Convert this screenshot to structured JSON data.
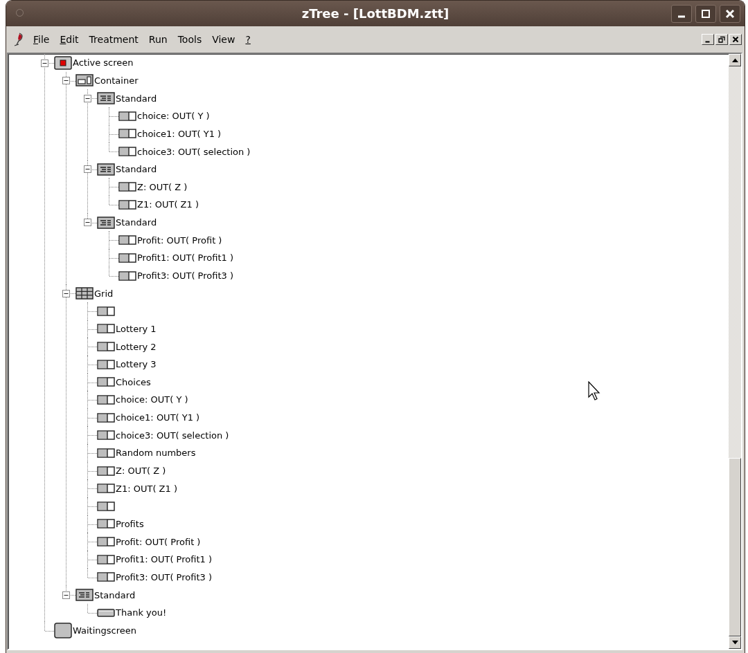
{
  "window": {
    "title": "zTree - [LottBDM.ztt]"
  },
  "menu": [
    {
      "label": "File",
      "mnemonic": true
    },
    {
      "label": "Edit",
      "mnemonic": true
    },
    {
      "label": "Treatment",
      "mnemonic": false
    },
    {
      "label": "Run",
      "mnemonic": false
    },
    {
      "label": "Tools",
      "mnemonic": false
    },
    {
      "label": "View",
      "mnemonic": false
    },
    {
      "label": "?",
      "mnemonic": true
    }
  ],
  "tree": [
    {
      "label": "Active screen",
      "kind": "active-screen",
      "expanded": true,
      "children": [
        {
          "label": "Container",
          "kind": "container",
          "expanded": true,
          "children": [
            {
              "label": "Standard",
              "kind": "standard",
              "expanded": true,
              "children": [
                {
                  "label": "choice: OUT( Y )",
                  "kind": "item"
                },
                {
                  "label": "choice1: OUT( Y1 )",
                  "kind": "item"
                },
                {
                  "label": "choice3: OUT( selection )",
                  "kind": "item"
                }
              ]
            },
            {
              "label": "Standard",
              "kind": "standard",
              "expanded": true,
              "children": [
                {
                  "label": "Z: OUT( Z )",
                  "kind": "item"
                },
                {
                  "label": "Z1: OUT( Z1 )",
                  "kind": "item"
                }
              ]
            },
            {
              "label": "Standard",
              "kind": "standard",
              "expanded": true,
              "children": [
                {
                  "label": "Profit: OUT( Profit )",
                  "kind": "item"
                },
                {
                  "label": "Profit1: OUT( Profit1 )",
                  "kind": "item"
                },
                {
                  "label": "Profit3: OUT( Profit3 )",
                  "kind": "item"
                }
              ]
            }
          ]
        },
        {
          "label": "Grid",
          "kind": "grid",
          "expanded": true,
          "children": [
            {
              "kind": "item"
            },
            {
              "label": "Lottery 1",
              "kind": "item"
            },
            {
              "label": "Lottery 2",
              "kind": "item"
            },
            {
              "label": "Lottery 3",
              "kind": "item"
            },
            {
              "label": "Choices",
              "kind": "item"
            },
            {
              "label": "choice: OUT( Y )",
              "kind": "item"
            },
            {
              "label": "choice1: OUT( Y1 )",
              "kind": "item"
            },
            {
              "label": "choice3: OUT( selection )",
              "kind": "item"
            },
            {
              "label": "Random numbers",
              "kind": "item"
            },
            {
              "label": "Z: OUT( Z )",
              "kind": "item"
            },
            {
              "label": "Z1: OUT( Z1 )",
              "kind": "item"
            },
            {
              "kind": "item"
            },
            {
              "label": "Profits",
              "kind": "item"
            },
            {
              "label": "Profit: OUT( Profit )",
              "kind": "item"
            },
            {
              "label": "Profit1: OUT( Profit1 )",
              "kind": "item"
            },
            {
              "label": "Profit3: OUT( Profit3 )",
              "kind": "item"
            }
          ]
        },
        {
          "label": "Standard",
          "kind": "standard",
          "expanded": true,
          "children": [
            {
              "label": "Thank you!",
              "kind": "button"
            }
          ]
        }
      ]
    },
    {
      "label": "Waitingscreen",
      "kind": "screen"
    }
  ]
}
